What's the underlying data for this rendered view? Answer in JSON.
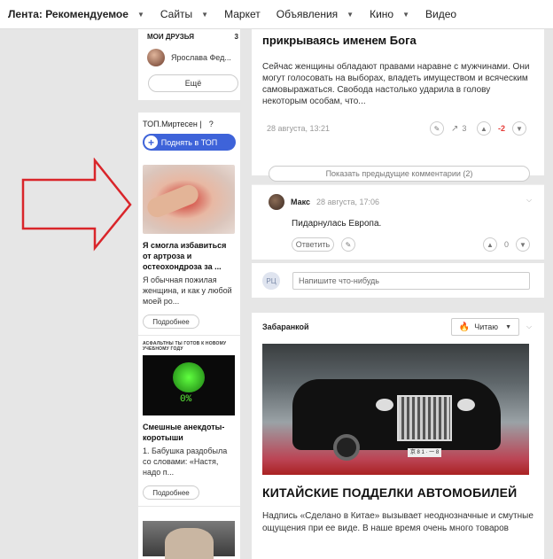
{
  "nav": {
    "items": [
      {
        "label": "Лента: Рекомендуемое",
        "caret": true
      },
      {
        "label": "Сайты",
        "caret": true
      },
      {
        "label": "Маркет",
        "caret": false
      },
      {
        "label": "Объявления",
        "caret": true
      },
      {
        "label": "Кино",
        "caret": true
      },
      {
        "label": "Видео",
        "caret": false
      }
    ]
  },
  "friends": {
    "title": "МОИ ДРУЗЬЯ",
    "count": "3",
    "first_name": "Ярослава Фед...",
    "more_label": "Ещё"
  },
  "promo": {
    "brand": "ТОП.Миртесен",
    "brand_sep": "|",
    "help": "?",
    "up_label": "Поднять в ТОП",
    "plus": "+",
    "items": [
      {
        "title": "Я смогла избавиться от артроза и остеохондроза за ...",
        "text": "Я обычная пожилая женщина, и как у любой моей ро...",
        "button": "Подробнее"
      },
      {
        "banner": "АСФАЛЬТНЫ ТЫ ГОТОВ К НОВОМУ УЧЕБНОМУ ГОДУ",
        "pct": "0%",
        "title": "Смешные анекдоты-коротыши",
        "text": "1. Бабушка раздобыла со словами: «Настя, надо п...",
        "button": "Подробнее"
      }
    ]
  },
  "article": {
    "title": "прикрываясь именем Бога",
    "text": "Сейчас женщины обладают правами наравне с мужчинами. Они могут голосовать на выборах, владеть имуществом и всяческим самовыражаться. Свобода настолько ударила в голову некоторым особам, что...",
    "date": "28 августа, 13:21",
    "score": "-2",
    "show_prev": "Показать предыдущие комментарии (2)"
  },
  "comment": {
    "author": "Макс",
    "date": "28 августа, 17:06",
    "text": "Пидарнулась Европа.",
    "reply_label": "Ответить",
    "score": "0"
  },
  "reply": {
    "avatar": "РЦ",
    "placeholder": "Напишите что-нибудь"
  },
  "card2": {
    "source": "Забаранкой",
    "read_label": "Читаю",
    "plate": "京 8 1 · 一 8",
    "title": "КИТАЙСКИЕ ПОДДЕЛКИ АВТОМОБИЛЕЙ",
    "text": "Надпись «Сделано в Китае» вызывает неоднозначные и смутные ощущения при ее виде. В наше время очень много товаров"
  },
  "colors": {
    "accent": "#3e63d9",
    "arrow": "#d9252a",
    "negative": "#e53935",
    "background": "#e6e6e6"
  }
}
